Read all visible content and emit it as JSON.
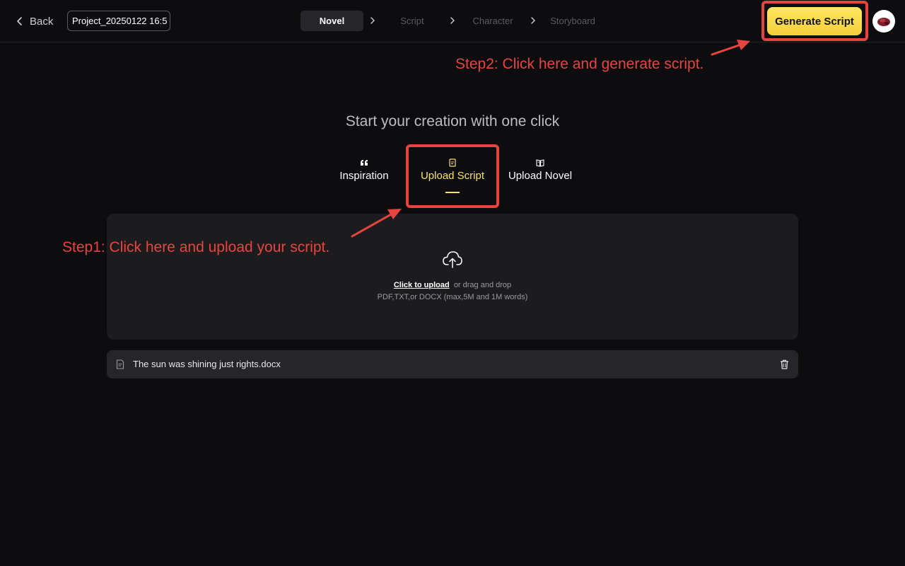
{
  "header": {
    "back_label": "Back",
    "project_name": "Project_20250122 16:5",
    "steps": [
      "Novel",
      "Script",
      "Character",
      "Storyboard"
    ],
    "active_step": "Novel",
    "generate_label": "Generate Script"
  },
  "annotations": {
    "step2": "Step2: Click here and generate script.",
    "step1": "Step1: Click here and upload your script.",
    "color": "#e8443f"
  },
  "main": {
    "headline": "Start your creation with one click",
    "tabs": [
      {
        "label": "Inspiration",
        "icon": "quote-icon"
      },
      {
        "label": "Upload Script",
        "icon": "document-icon"
      },
      {
        "label": "Upload Novel",
        "icon": "book-icon"
      }
    ],
    "active_tab": "Upload Script",
    "upload": {
      "link_text": "Click to upload",
      "hint_text": "or drag and drop",
      "formats_text": "PDF,TXT,or DOCX (max,5M and 1M words)"
    },
    "file": {
      "name": "The sun was shining just rights.docx"
    }
  },
  "colors": {
    "accent_yellow": "#f7e36a",
    "background": "#0d0d0f",
    "panel": "#1c1c1e"
  }
}
